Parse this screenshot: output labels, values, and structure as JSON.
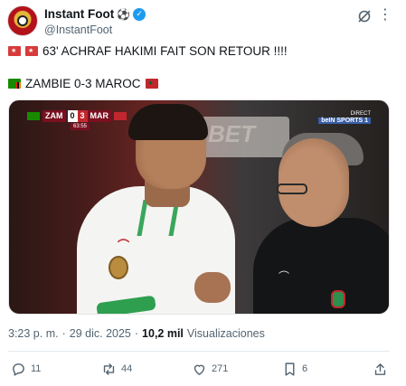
{
  "account": {
    "name": "Instant Foot",
    "name_emoji": "⚽",
    "handle": "@InstantFoot",
    "verified": true,
    "icons": [
      "avatar",
      "verified-badge-icon",
      "grok-icon",
      "more-icon"
    ]
  },
  "tweet": {
    "line1": "63' ACHRAF HAKIMI FAIT SON RETOUR !!!!",
    "line2": "ZAMBIE 0-3 MAROC"
  },
  "media": {
    "score": {
      "home": "ZAM",
      "home_score": "0",
      "away_score": "3",
      "away": "MAR",
      "clock": "63:55"
    },
    "channel": {
      "label": "DIRECT",
      "name": "beIN SPORTS 1"
    },
    "background_text": "BET"
  },
  "meta": {
    "time": "3:23 p. m.",
    "separator": "·",
    "date": "29 dic. 2025",
    "separator2": "·",
    "views_count": "10,2 mil",
    "views_label": "Visualizaciones"
  },
  "actions": {
    "replies": "11",
    "reposts": "44",
    "likes": "271",
    "bookmarks": "6"
  },
  "colors": {
    "accent": "#1d9bf0",
    "muted": "#536471",
    "text": "#0f1419"
  }
}
